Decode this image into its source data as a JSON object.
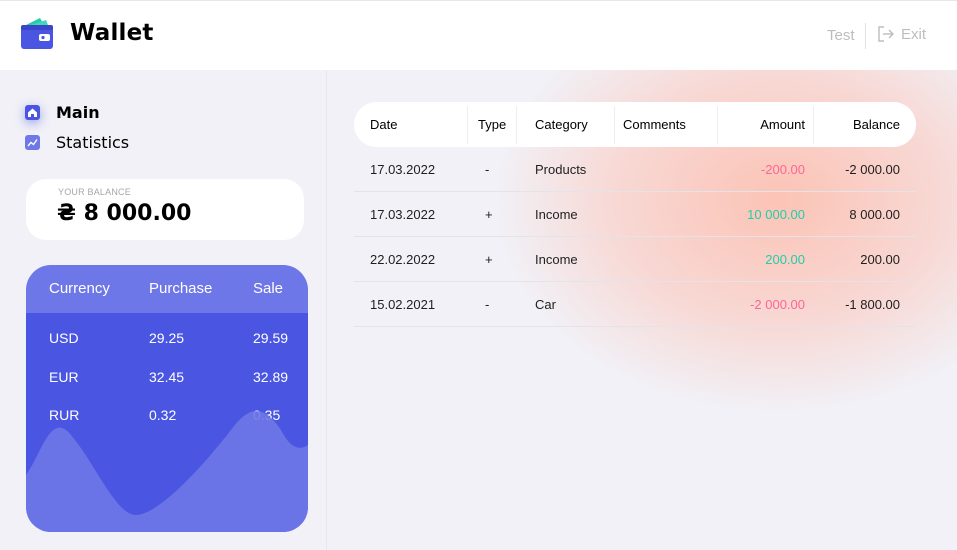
{
  "header": {
    "app_title": "Wallet",
    "user_name": "Test",
    "exit_label": "Exit"
  },
  "sidebar": {
    "nav": [
      {
        "label": "Main",
        "icon": "home-icon",
        "active": true
      },
      {
        "label": "Statistics",
        "icon": "stats-icon",
        "active": false
      }
    ],
    "balance": {
      "label": "Your balance",
      "currency_symbol": "₴",
      "value": "8 000.00"
    },
    "currency_table": {
      "headers": [
        "Currency",
        "Purchase",
        "Sale"
      ],
      "rows": [
        {
          "currency": "USD",
          "purchase": "29.25",
          "sale": "29.59"
        },
        {
          "currency": "EUR",
          "purchase": "32.45",
          "sale": "32.89"
        },
        {
          "currency": "RUR",
          "purchase": "0.32",
          "sale": "0.35"
        }
      ]
    }
  },
  "transactions": {
    "headers": {
      "date": "Date",
      "type": "Type",
      "category": "Category",
      "comments": "Comments",
      "amount": "Amount",
      "balance": "Balance"
    },
    "rows": [
      {
        "date": "17.03.2022",
        "type": "-",
        "category": "Products",
        "comments": "",
        "amount": "-200.00",
        "balance": "-2 000.00"
      },
      {
        "date": "17.03.2022",
        "type": "+",
        "category": "Income",
        "comments": "",
        "amount": "10 000.00",
        "balance": "8 000.00"
      },
      {
        "date": "22.02.2022",
        "type": "+",
        "category": "Income",
        "comments": "",
        "amount": "200.00",
        "balance": "200.00"
      },
      {
        "date": "15.02.2021",
        "type": "-",
        "category": "Car",
        "comments": "",
        "amount": "-2 000.00",
        "balance": "-1 800.00"
      }
    ]
  },
  "colors": {
    "accent": "#4a56e2",
    "income": "#24cca7",
    "expense": "#ff6596"
  }
}
